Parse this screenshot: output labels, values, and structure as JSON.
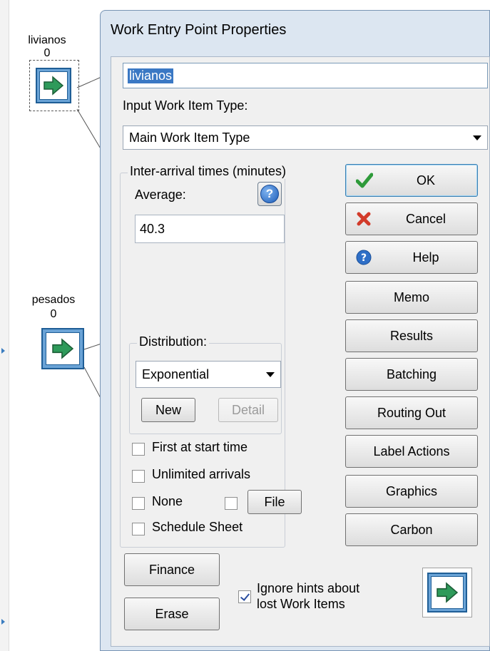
{
  "canvas": {
    "blocks": [
      {
        "name": "livianos",
        "count": "0"
      },
      {
        "name": "pesados",
        "count": "0"
      }
    ]
  },
  "dialog": {
    "title": "Work Entry Point Properties",
    "name_value": "livianos",
    "input_type_label": "Input Work Item Type:",
    "input_type_value": "Main Work Item Type",
    "inter_arrival_title": "Inter-arrival times (minutes)",
    "average_label": "Average:",
    "average_value": "40.3",
    "help_icon_glyph": "?",
    "distribution_title": "Distribution:",
    "distribution_value": "Exponential",
    "new_label": "New",
    "detail_label": "Detail",
    "checkboxes": {
      "first_at_start": {
        "label": "First at start time",
        "checked": false
      },
      "unlimited_arrivals": {
        "label": "Unlimited arrivals",
        "checked": false
      },
      "none": {
        "label": "None",
        "checked": false
      },
      "file_check": {
        "checked": false
      },
      "schedule_sheet": {
        "label": "Schedule Sheet",
        "checked": false
      },
      "ignore_hints": {
        "label_line1": "Ignore hints about",
        "label_line2": "lost Work Items",
        "checked": true
      }
    },
    "file_label": "File",
    "buttons": {
      "ok": "OK",
      "cancel": "Cancel",
      "help": "Help",
      "memo": "Memo",
      "results": "Results",
      "batching": "Batching",
      "routing_out": "Routing Out",
      "label_actions": "Label Actions",
      "graphics": "Graphics",
      "carbon": "Carbon",
      "finance": "Finance",
      "erase": "Erase"
    },
    "icons": {
      "ok": "green-checkmark-icon",
      "cancel": "red-x-icon",
      "help": "blue-question-icon",
      "block": "green-arrow-icon"
    }
  },
  "colors": {
    "dialog_frame": "#dce6f1",
    "selection": "#3a78c4",
    "block_blue": "#6aa3d6",
    "arrow_green": "#2e9a5a"
  }
}
